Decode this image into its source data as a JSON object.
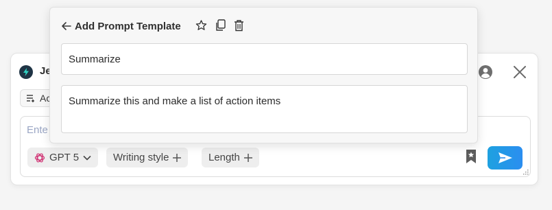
{
  "panel": {
    "brand_name": "Je",
    "add_chip_label": "Ac",
    "composer": {
      "placeholder": "Ente",
      "model_label": "GPT 5",
      "writing_style_label": "Writing style",
      "length_label": "Length"
    },
    "icons": {
      "brand": "bolt-logo-icon",
      "user": "user-circle-icon",
      "close": "close-icon",
      "add_chip": "playlist-add-icon",
      "model": "openai-icon",
      "bookmark": "bookmark-star-icon",
      "send": "send-icon"
    },
    "colors": {
      "send_accent": "#2b8ef0",
      "brand_logo_bg": "#1f3445"
    }
  },
  "popup": {
    "title": "Add Prompt Template",
    "name_value": "Summarize",
    "body_value": "Summarize this and make a list of action items",
    "icons": {
      "back": "arrow-left-icon",
      "star": "star-icon",
      "copy": "copy-icon",
      "delete": "trash-icon"
    }
  }
}
